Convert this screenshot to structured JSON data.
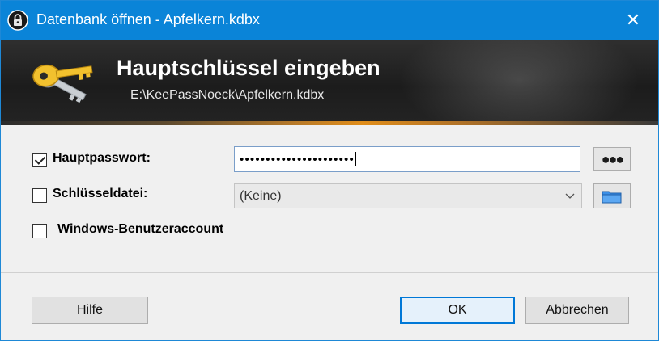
{
  "window": {
    "title": "Datenbank öffnen - Apfelkern.kdbx",
    "close_glyph": "✕"
  },
  "banner": {
    "heading": "Hauptschlüssel eingeben",
    "path": "E:\\KeePassNoeck\\Apfelkern.kdbx",
    "icon": "keys-icon"
  },
  "form": {
    "master_password": {
      "label": "Hauptpasswort:",
      "checked": true,
      "value_masked": "••••••••••••••••••••••",
      "toggle_label": "●●●"
    },
    "key_file": {
      "label": "Schlüsseldatei:",
      "checked": false,
      "selected": "(Keine)",
      "browse_icon": "folder-icon"
    },
    "windows_account": {
      "label": "Windows-Benutzeraccount",
      "checked": false
    }
  },
  "buttons": {
    "help": "Hilfe",
    "ok": "OK",
    "cancel": "Abbrechen"
  },
  "colors": {
    "titlebar": "#0a84d8",
    "accent": "#0078d7",
    "banner_stripe": "#e08d1a"
  }
}
